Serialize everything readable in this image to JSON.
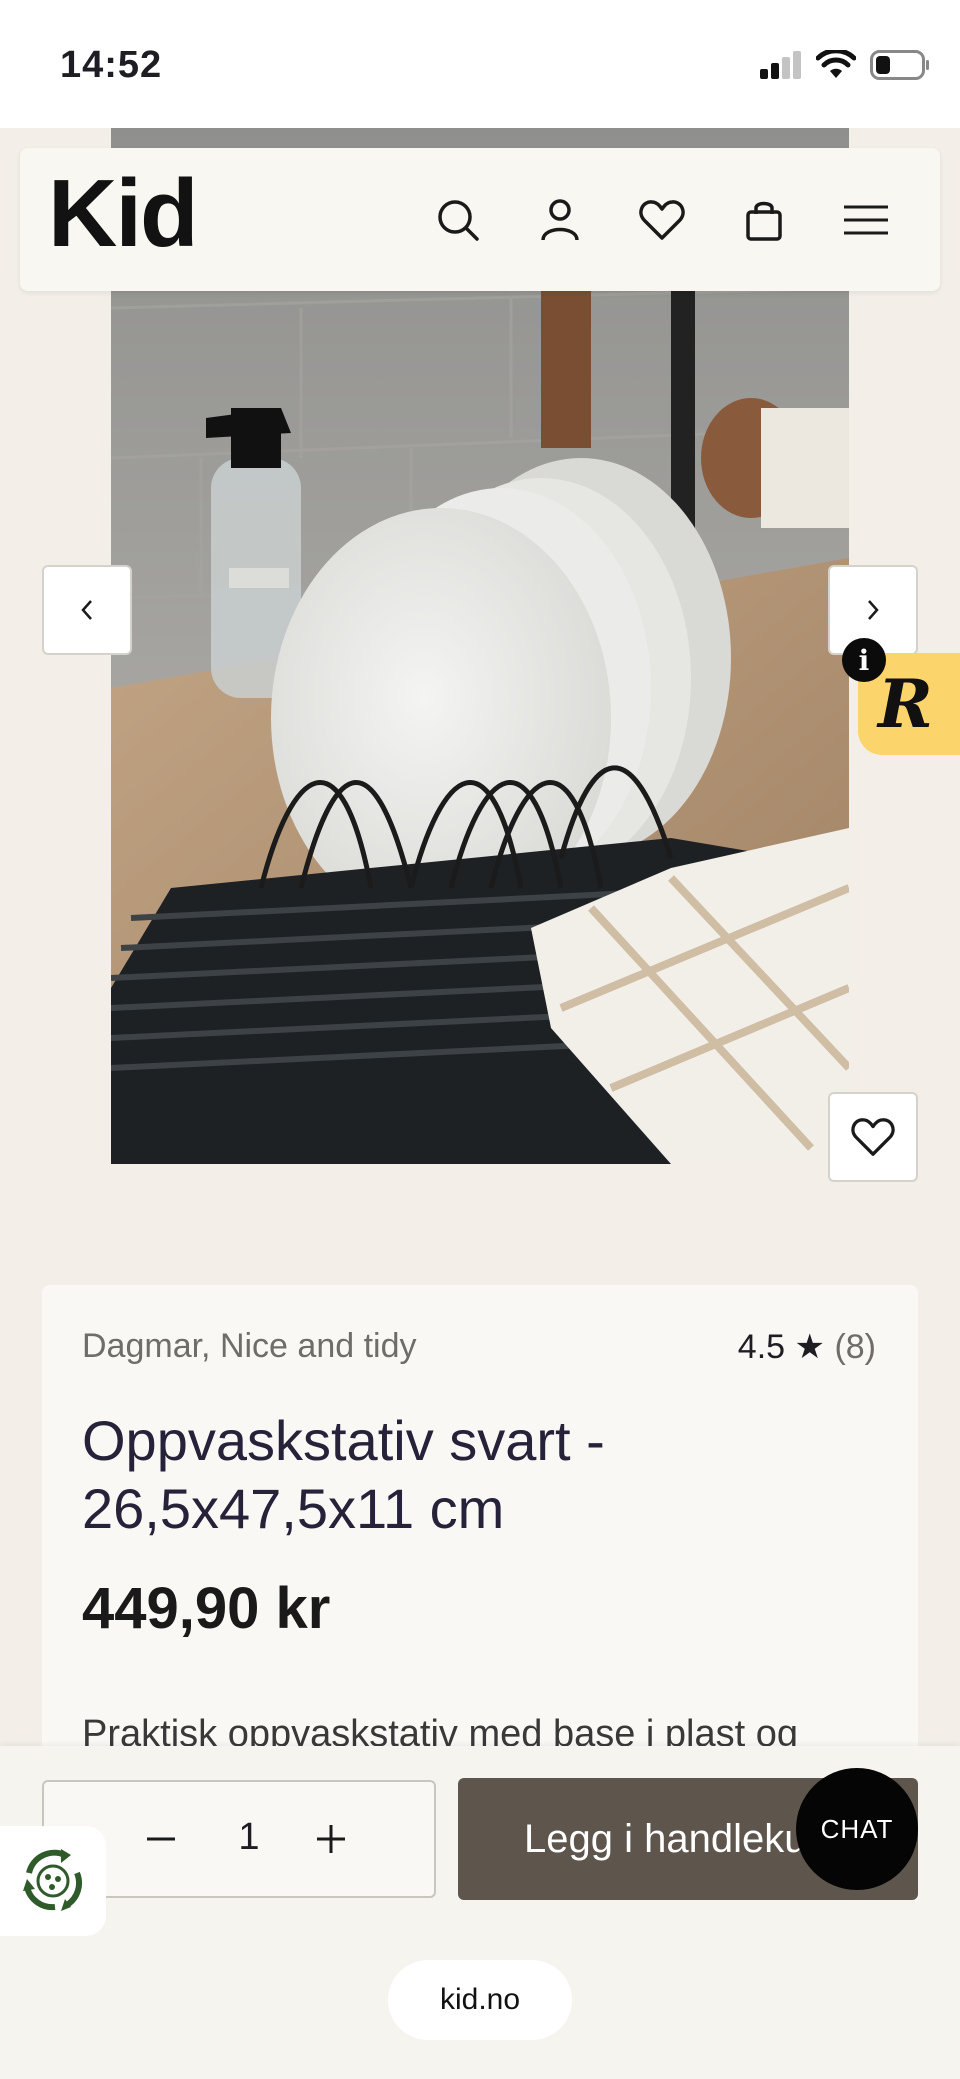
{
  "status_bar": {
    "time": "14:52",
    "icons": [
      "cellular-signal-icon",
      "wifi-icon",
      "battery-icon"
    ]
  },
  "header": {
    "logo": "Kid",
    "icons": [
      "search-icon",
      "account-icon",
      "wishlist-heart-icon",
      "shopping-bag-icon",
      "menu-icon"
    ]
  },
  "gallery": {
    "image_alt": "Oppvaskstativ svart med hvite tallerkener",
    "prev_icon": "chevron-left-icon",
    "next_icon": "chevron-right-icon",
    "wishlist_icon": "heart-icon"
  },
  "review_widget": {
    "letter": "R",
    "info": "i"
  },
  "product": {
    "brand": "Dagmar, Nice and tidy",
    "rating": "4.5 ★",
    "review_count": "(8)",
    "title": "Oppvaskstativ svart - 26,5x47,5x11 cm",
    "price": "449,90 kr",
    "description": "Praktisk oppvaskstativ med base i plast og"
  },
  "purchase": {
    "quantity": "1",
    "add_to_cart_label": "Legg i handlekurv",
    "chat_label": "CHAT"
  },
  "browser": {
    "url": "kid.no"
  },
  "colors": {
    "accent": "#5e554d",
    "background": "#f3efe8",
    "badge": "#fcd46c"
  }
}
